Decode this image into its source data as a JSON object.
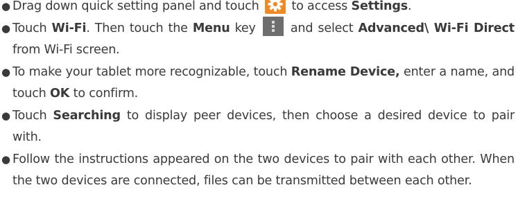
{
  "steps": [
    {
      "t1": "Drag down quick setting panel and touch",
      "t2": "to access",
      "b1": "Settings",
      "t3": ".",
      "icon": "settings-gear-icon"
    },
    {
      "t1": "Touch",
      "b1": "Wi-Fi",
      "t2": ". Then touch the",
      "b2": "Menu",
      "t3": "key",
      "t4": "and select",
      "b3": "Advanced\\ Wi-Fi Direct",
      "t5": "from Wi-Fi screen.",
      "icon": "menu-key-icon"
    },
    {
      "t1": "To make your tablet more recognizable, touch",
      "b1": "Rename Device,",
      "t2": "enter a name, and touch",
      "b2": "OK",
      "t3": "to confirm."
    },
    {
      "t1": "Touch",
      "b1": "Searching",
      "t2": "to display peer devices, then choose a desired device to pair with."
    },
    {
      "t1": "Follow the instructions appeared on the two devices to pair with each other. When the two devices are connected, files can be transmitted between each other."
    }
  ],
  "colors": {
    "text": "#3a3a3a",
    "settings_icon_bg": "#f08a24",
    "menu_icon_bg": "#6e6e6e"
  }
}
